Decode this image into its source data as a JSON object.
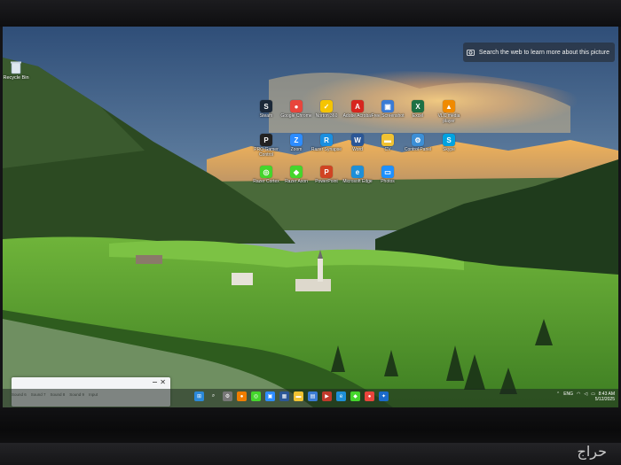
{
  "search_chip": {
    "text": "Search the web to learn more about this picture",
    "icon": "camera-icon"
  },
  "recycle_bin": {
    "label": "Recycle Bin",
    "icon": "recycle-bin-icon"
  },
  "desktop_icons": [
    {
      "label": "Steam",
      "color": "#1b2838",
      "glyph": "S"
    },
    {
      "label": "Google Chrome",
      "color": "#e8453c",
      "glyph": "●"
    },
    {
      "label": "Norton 360",
      "color": "#f5c400",
      "glyph": "✓"
    },
    {
      "label": "Adobe Acrobat",
      "color": "#d7261e",
      "glyph": "A"
    },
    {
      "label": "Free Screenshot",
      "color": "#3a7bd5",
      "glyph": "▣"
    },
    {
      "label": "Excel",
      "color": "#1d7044",
      "glyph": "X"
    },
    {
      "label": "VLC media player",
      "color": "#f08a00",
      "glyph": "▲"
    },
    {
      "label": "PRO Gamer Control",
      "color": "#222222",
      "glyph": "P"
    },
    {
      "label": "Zoom",
      "color": "#2d8cff",
      "glyph": "Z"
    },
    {
      "label": "Razer Synapse",
      "color": "#1a8fe0",
      "glyph": "R"
    },
    {
      "label": "Word",
      "color": "#2b5797",
      "glyph": "W"
    },
    {
      "label": "CV",
      "color": "#f1c232",
      "glyph": "▬"
    },
    {
      "label": "Control Panel",
      "color": "#3c8fd6",
      "glyph": "⚙"
    },
    {
      "label": "Skype",
      "color": "#00a3e0",
      "glyph": "S"
    },
    {
      "label": "Razer Cortex",
      "color": "#44d62c",
      "glyph": "◎"
    },
    {
      "label": "Razer Axon",
      "color": "#44d62c",
      "glyph": "◆"
    },
    {
      "label": "PowerPoint",
      "color": "#d04423",
      "glyph": "P"
    },
    {
      "label": "Microsoft Edge",
      "color": "#1e8fd8",
      "glyph": "e"
    },
    {
      "label": "Photos",
      "color": "#1e90ff",
      "glyph": "▭"
    }
  ],
  "sound_popup": {
    "tabs": [
      "Sound 6",
      "Sound 7",
      "Sound 8",
      "Sound 9",
      "Input"
    ],
    "close": "✕"
  },
  "taskbar": {
    "icons": [
      {
        "name": "start",
        "color": "#2b88d8",
        "glyph": "⊞"
      },
      {
        "name": "search",
        "color": "transparent",
        "glyph": "⌕"
      },
      {
        "name": "settings",
        "color": "#777",
        "glyph": "⚙"
      },
      {
        "name": "app-orange",
        "color": "#f07d00",
        "glyph": "●"
      },
      {
        "name": "app-green",
        "color": "#44d62c",
        "glyph": "◎"
      },
      {
        "name": "app-blue",
        "color": "#2d8cff",
        "glyph": "▣"
      },
      {
        "name": "calendar",
        "color": "#2b5797",
        "glyph": "▦"
      },
      {
        "name": "explorer",
        "color": "#f1c232",
        "glyph": "▬"
      },
      {
        "name": "store",
        "color": "#3a7bd5",
        "glyph": "▤"
      },
      {
        "name": "media",
        "color": "#c0392b",
        "glyph": "▶"
      },
      {
        "name": "edge",
        "color": "#1e8fd8",
        "glyph": "e"
      },
      {
        "name": "razer",
        "color": "#44d62c",
        "glyph": "◆"
      },
      {
        "name": "chrome",
        "color": "#e8453c",
        "glyph": "●"
      },
      {
        "name": "games",
        "color": "#1b6ac9",
        "glyph": "✦"
      }
    ],
    "tray_language": "ENG",
    "time": "8:43 AM",
    "date": "5/12/2025"
  },
  "watermark": "حراج"
}
